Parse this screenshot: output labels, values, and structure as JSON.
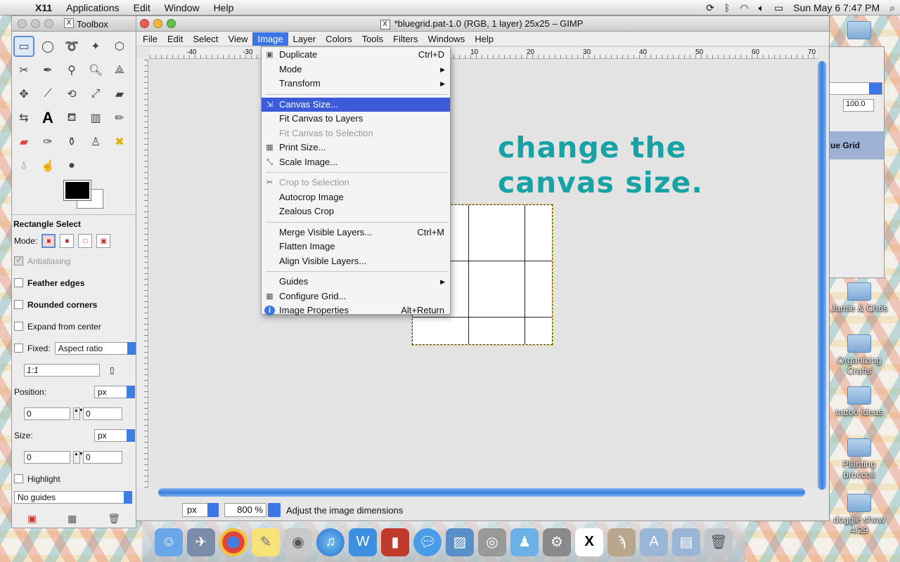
{
  "mac_menubar": {
    "app": "X11",
    "items": [
      "Applications",
      "Edit",
      "Window",
      "Help"
    ],
    "clock": "Sun May 6  7:47 PM"
  },
  "toolbox": {
    "title": "Toolbox",
    "tool_options_title": "Rectangle Select",
    "mode_label": "Mode:",
    "antialiasing": "Antialiasing",
    "feather": "Feather edges",
    "rounded": "Rounded corners",
    "expand": "Expand from center",
    "fixed": "Fixed:",
    "fixed_value": "Aspect ratio",
    "ratio": "1:1",
    "position_label": "Position:",
    "position_unit": "px",
    "position_x": "0",
    "position_y": "0",
    "size_label": "Size:",
    "size_unit": "px",
    "size_w": "0",
    "size_h": "0",
    "highlight": "Highlight",
    "guides": "No guides"
  },
  "window": {
    "title": "*bluegrid.pat-1.0 (RGB, 1 layer) 25x25 – GIMP",
    "menu": [
      "File",
      "Edit",
      "Select",
      "View",
      "Image",
      "Layer",
      "Colors",
      "Tools",
      "Filters",
      "Windows",
      "Help"
    ],
    "active_menu": "Image",
    "ruler_labels": [
      "-40",
      "-30",
      "10",
      "20",
      "30",
      "40",
      "50",
      "60",
      "70"
    ],
    "overlay_line1": "change the",
    "overlay_line2": "canvas size.",
    "status_unit": "px",
    "zoom": "800 %",
    "status_text": "Adjust the image dimensions"
  },
  "image_menu": {
    "items": [
      {
        "label": "Duplicate",
        "shortcut": "Ctrl+D",
        "icon": "duplicate-icon"
      },
      {
        "label": "Mode",
        "submenu": true
      },
      {
        "label": "Transform",
        "submenu": true
      },
      {
        "label": "Canvas Size...",
        "highlighted": true,
        "icon": "canvas-size-icon"
      },
      {
        "label": "Fit Canvas to Layers"
      },
      {
        "label": "Fit Canvas to Selection",
        "disabled": true
      },
      {
        "label": "Print Size...",
        "icon": "print-size-icon"
      },
      {
        "label": "Scale Image...",
        "icon": "scale-image-icon"
      },
      {
        "label": "Crop to Selection",
        "disabled": true,
        "icon": "crop-icon"
      },
      {
        "label": "Autocrop Image"
      },
      {
        "label": "Zealous Crop"
      },
      {
        "label": "Merge Visible Layers...",
        "shortcut": "Ctrl+M"
      },
      {
        "label": "Flatten Image"
      },
      {
        "label": "Align Visible Layers..."
      },
      {
        "label": "Guides",
        "submenu": true
      },
      {
        "label": "Configure Grid...",
        "icon": "grid-icon"
      },
      {
        "label": "Image Properties",
        "shortcut": "Alt+Return",
        "icon": "info-icon"
      }
    ]
  },
  "layers_dock": {
    "opacity": "100.0",
    "layer_name": "ue Grid"
  },
  "desktop_icons": [
    "Jamie & Chris",
    "Organizing Crafts",
    "tattoo ideas",
    "Planting broccoli",
    "doggie show 4/29"
  ]
}
